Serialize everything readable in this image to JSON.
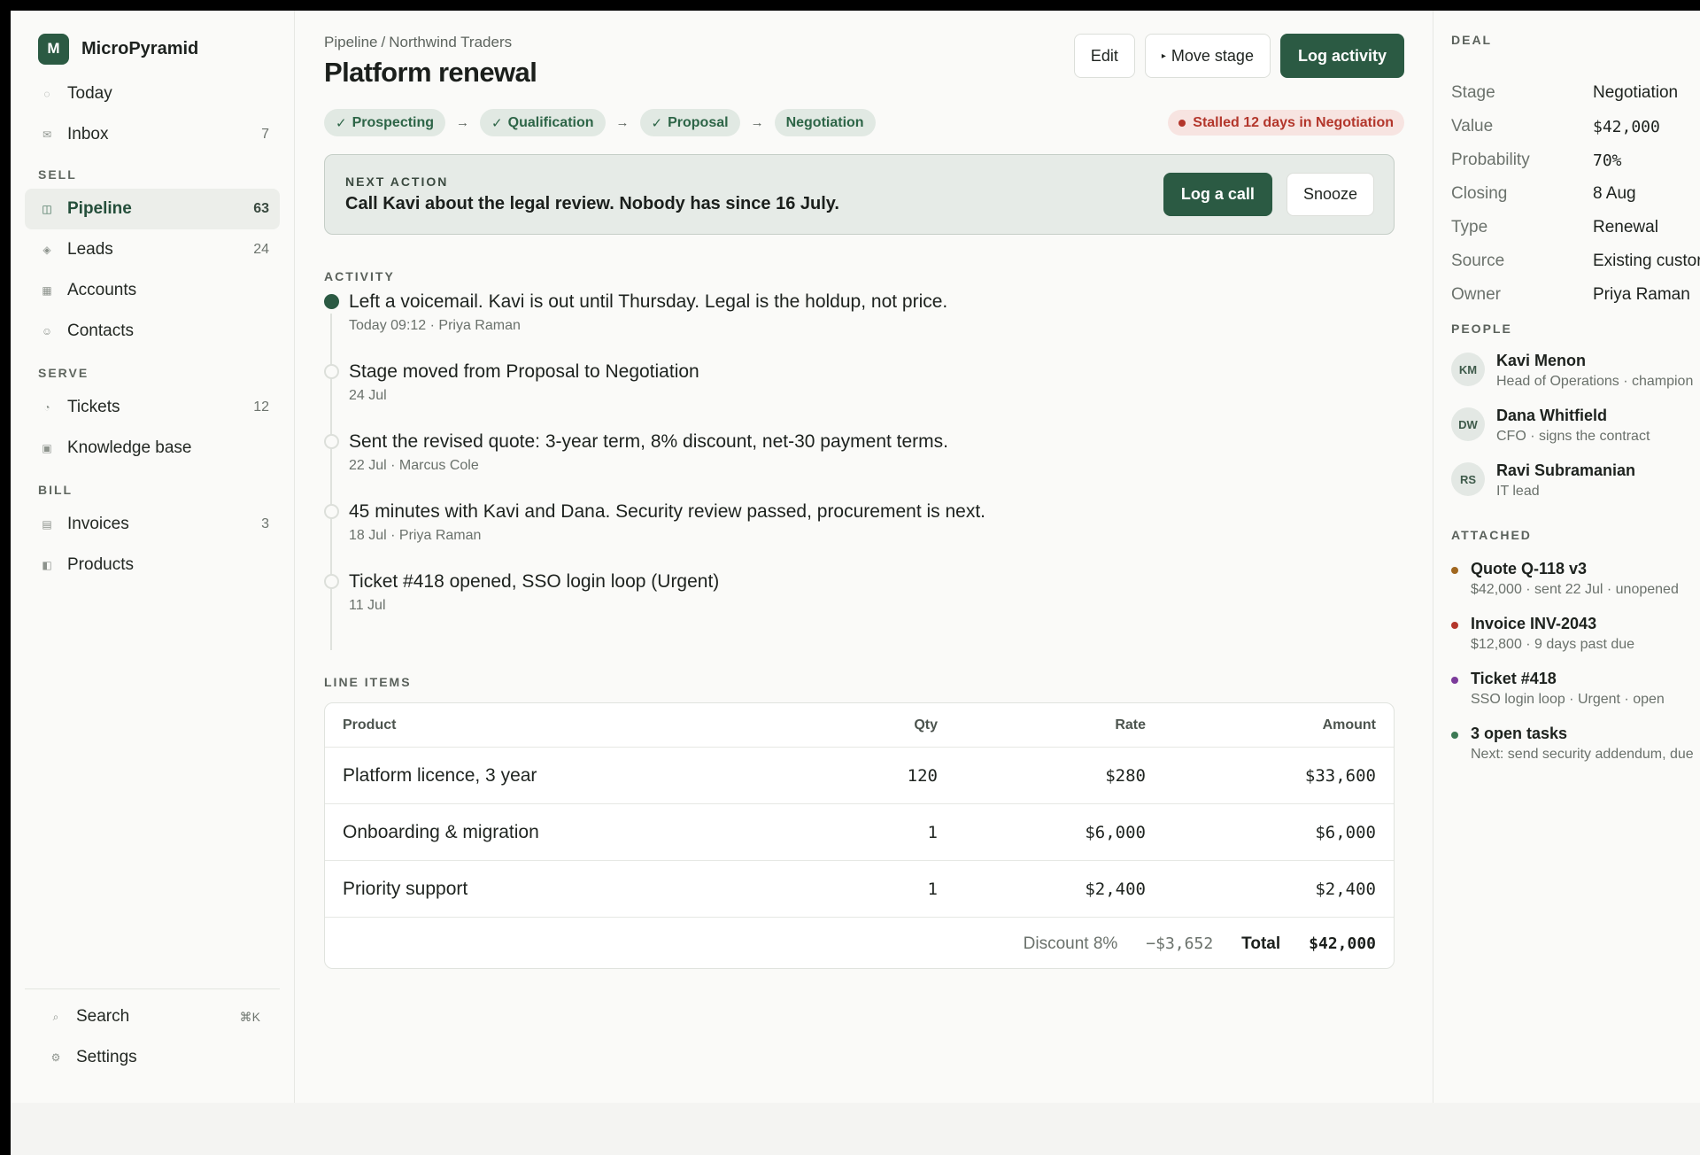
{
  "brand": {
    "logo_letter": "M",
    "name": "MicroPyramid"
  },
  "nav": {
    "top": [
      {
        "icon": "circle-icon",
        "glyph": "◌",
        "label": "Today",
        "count": ""
      },
      {
        "icon": "inbox-icon",
        "glyph": "✉",
        "label": "Inbox",
        "count": "7"
      }
    ],
    "sell_label": "SELL",
    "sell": [
      {
        "icon": "pipeline-icon",
        "glyph": "◫",
        "label": "Pipeline",
        "count": "63",
        "active": true
      },
      {
        "icon": "leads-icon",
        "glyph": "◈",
        "label": "Leads",
        "count": "24"
      },
      {
        "icon": "accounts-icon",
        "glyph": "▦",
        "label": "Accounts",
        "count": ""
      },
      {
        "icon": "contacts-icon",
        "glyph": "☺",
        "label": "Contacts",
        "count": ""
      }
    ],
    "serve_label": "SERVE",
    "serve": [
      {
        "icon": "tickets-icon",
        "glyph": "◔",
        "label": "Tickets",
        "count": "12"
      },
      {
        "icon": "knowledge-base-icon",
        "glyph": "▣",
        "label": "Knowledge base",
        "count": ""
      }
    ],
    "bill_label": "BILL",
    "bill": [
      {
        "icon": "invoices-icon",
        "glyph": "▤",
        "label": "Invoices",
        "count": "3"
      },
      {
        "icon": "products-icon",
        "glyph": "◧",
        "label": "Products",
        "count": ""
      }
    ],
    "bottom": {
      "search_label": "Search",
      "search_shortcut": "⌘K",
      "search_glyph": "⌕",
      "settings_label": "Settings",
      "settings_glyph": "⚙"
    }
  },
  "header": {
    "breadcrumb_parent": "Pipeline",
    "breadcrumb_sep": "/",
    "breadcrumb_current": "Northwind Traders",
    "title": "Platform renewal",
    "edit_label": "Edit",
    "move_stage_label": "Move stage",
    "move_stage_glyph": "▸",
    "log_activity_label": "Log activity"
  },
  "stages": {
    "items": [
      {
        "label": "Prospecting",
        "done": true
      },
      {
        "label": "Qualification",
        "done": true
      },
      {
        "label": "Proposal",
        "done": true
      },
      {
        "label": "Negotiation",
        "done": false
      }
    ],
    "check_glyph": "✓",
    "arrow_glyph": "→",
    "stalled_text": "Stalled 12 days in Negotiation"
  },
  "next_action": {
    "eyebrow": "NEXT ACTION",
    "message": "Call Kavi about the legal review. Nobody has since 16 July.",
    "primary_label": "Log a call",
    "secondary_label": "Snooze"
  },
  "activity": {
    "title": "ACTIVITY",
    "items": [
      {
        "text": "Left a voicemail. Kavi is out until Thursday. Legal is the holdup, not price.",
        "meta": "Today 09:12 · Priya Raman",
        "current": true
      },
      {
        "text": "Stage moved from Proposal to Negotiation",
        "meta": "24 Jul",
        "current": false
      },
      {
        "text": "Sent the revised quote: 3-year term, 8% discount, net-30 payment terms.",
        "meta": "22 Jul · Marcus Cole",
        "current": false
      },
      {
        "text": "45 minutes with Kavi and Dana. Security review passed, procurement is next.",
        "meta": "18 Jul · Priya Raman",
        "current": false
      },
      {
        "text": "Ticket #418 opened, SSO login loop (Urgent)",
        "meta": "11 Jul",
        "current": false
      }
    ]
  },
  "line_items": {
    "title": "LINE ITEMS",
    "headers": [
      "Product",
      "Qty",
      "Rate",
      "Amount"
    ],
    "rows": [
      [
        "Platform licence, 3 year",
        "120",
        "$280",
        "$33,600"
      ],
      [
        "Onboarding & migration",
        "1",
        "$6,000",
        "$6,000"
      ],
      [
        "Priority support",
        "1",
        "$2,400",
        "$2,400"
      ]
    ],
    "discount_label": "Discount 8%",
    "discount_value": "−$3,652",
    "total_label": "Total",
    "total_value": "$42,000"
  },
  "deal": {
    "title": "DEAL",
    "fields": [
      {
        "key": "Stage",
        "value": "Negotiation",
        "mono": false
      },
      {
        "key": "Value",
        "value": "$42,000",
        "mono": true
      },
      {
        "key": "Probability",
        "value": "70%",
        "mono": true
      },
      {
        "key": "Closing",
        "value": "8 Aug",
        "mono": false
      },
      {
        "key": "Type",
        "value": "Renewal",
        "mono": false
      },
      {
        "key": "Source",
        "value": "Existing custor",
        "mono": false
      },
      {
        "key": "Owner",
        "value": "Priya Raman",
        "mono": false
      }
    ]
  },
  "people": {
    "title": "PEOPLE",
    "items": [
      {
        "initials": "KM",
        "name": "Kavi Menon",
        "role": "Head of Operations · champion"
      },
      {
        "initials": "DW",
        "name": "Dana Whitfield",
        "role": "CFO · signs the contract"
      },
      {
        "initials": "RS",
        "name": "Ravi Subramanian",
        "role": "IT lead"
      }
    ]
  },
  "attached": {
    "title": "ATTACHED",
    "items": [
      {
        "color": "#a0671f",
        "title": "Quote Q-118 v3",
        "sub": "$42,000 · sent 22 Jul · unopened"
      },
      {
        "color": "#b3362b",
        "title": "Invoice INV-2043",
        "sub": "$12,800 · 9 days past due"
      },
      {
        "color": "#7b3b9a",
        "title": "Ticket #418",
        "sub": "SSO login loop · Urgent · open"
      },
      {
        "color": "#3c7a55",
        "title": "3 open tasks",
        "sub": "Next: send security addendum, due"
      }
    ]
  },
  "colors": {
    "accent": "#2b5a43",
    "danger": "#b3362b",
    "stage_pill_bg": "#e1e9e3"
  }
}
